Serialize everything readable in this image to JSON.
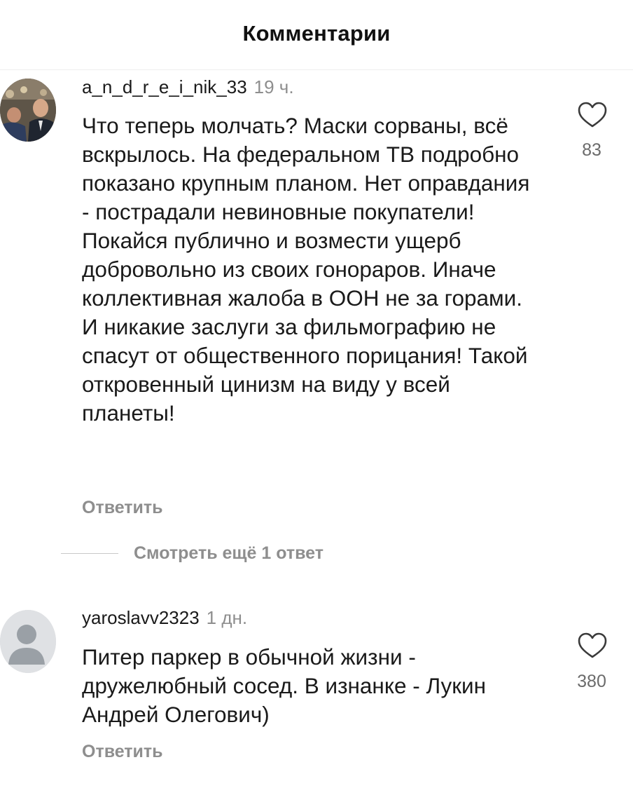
{
  "header": {
    "title": "Комментарии"
  },
  "comments": [
    {
      "username": "a_n_d_r_e_i_nik_33",
      "time": "19 ч.",
      "text": "Что теперь молчать? Маски сорваны, всё вскрылось. На федеральном ТВ подробно показано крупным планом. Нет оправдания - пострадали невиновные покупатели! Покайся публично и возмести ущерб добровольно из своих гонораров. Иначе коллективная жалоба в ООН не за горами. И никакие заслуги за фильмографию не спасут от общественного порицания! Такой откровенный цинизм на виду у всей планеты!",
      "likes": "83",
      "reply_label": "Ответить",
      "view_replies": "Смотреть ещё 1 ответ",
      "avatar": "user-photo"
    },
    {
      "username": "yaroslavv2323",
      "time": "1 дн.",
      "text": "Питер паркер в обычной жизни - дружелюбный сосед. В изнанке - Лукин Андрей Олегович)",
      "likes": "380",
      "reply_label": "Ответить",
      "avatar": "default-user-icon"
    }
  ],
  "icons": {
    "like": "heart-outline-icon"
  },
  "colors": {
    "text": "#1a1a1a",
    "muted": "#8e8e8e",
    "divider": "#efefef",
    "avatar_default_bg": "#d9dbde",
    "avatar_default_fg": "#9aa0a6"
  }
}
